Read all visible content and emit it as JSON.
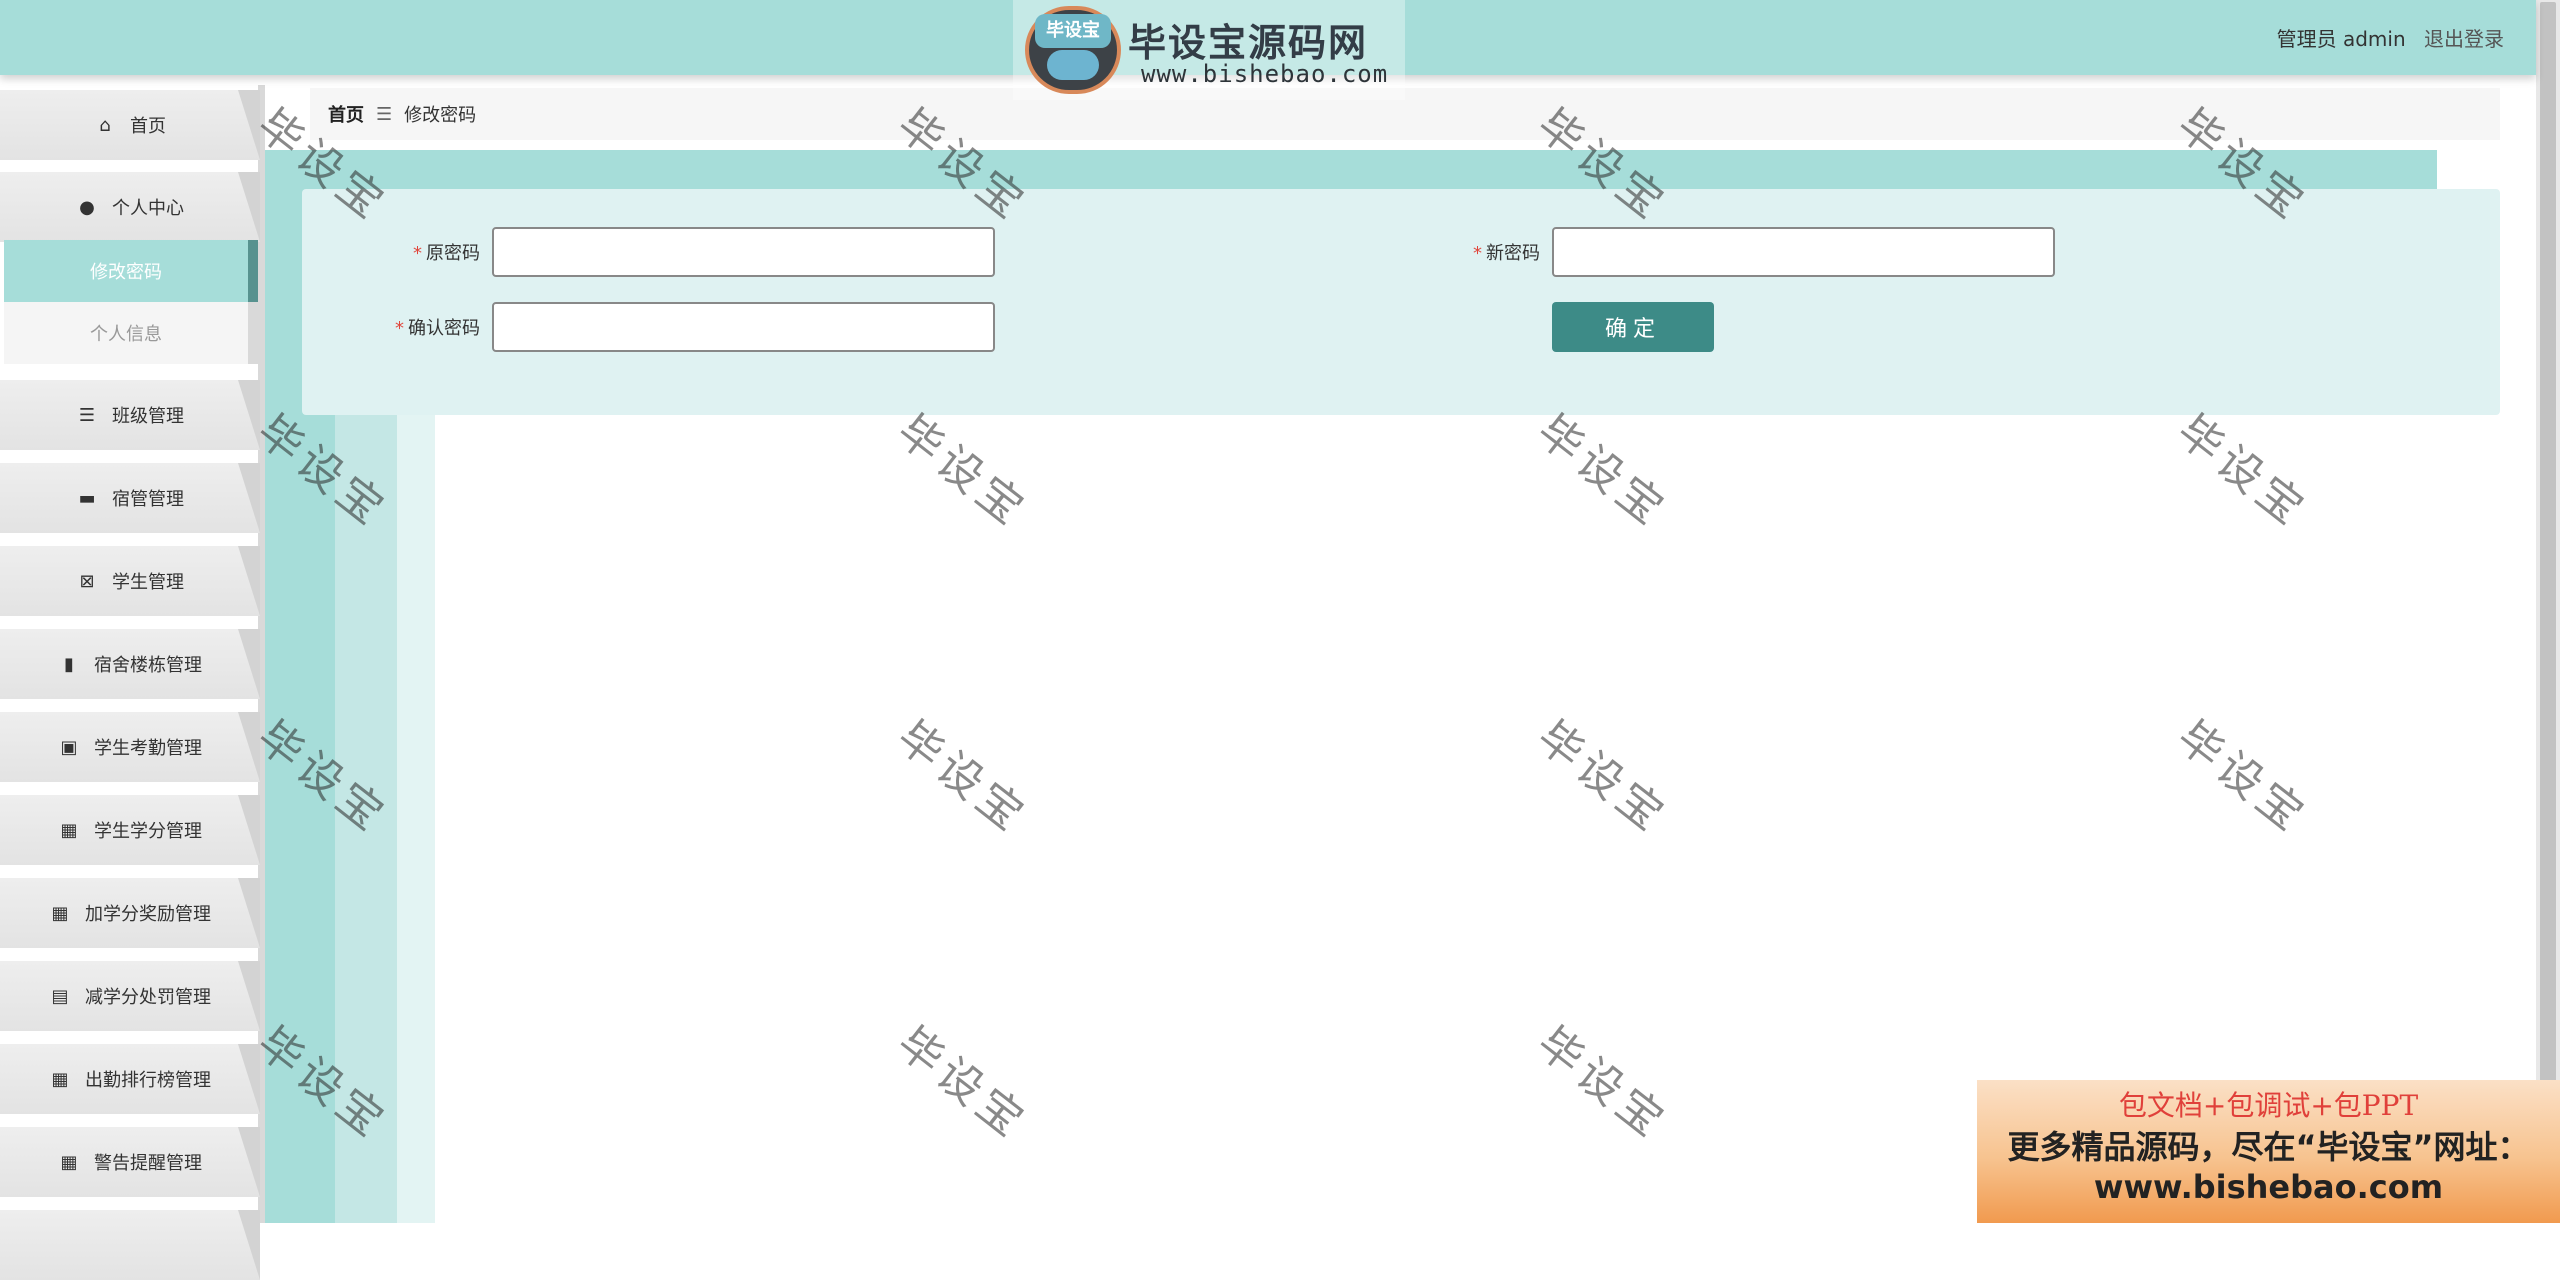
{
  "header": {
    "logo_cap": "毕设宝",
    "logo_title": "毕设宝源码网",
    "logo_url": "www.bishebao.com",
    "role_text": "管理员 admin",
    "logout_label": "退出登录"
  },
  "sidebar": {
    "items": [
      {
        "label": "首页",
        "icon": "home-icon",
        "glyph": "⌂"
      },
      {
        "label": "个人中心",
        "icon": "user-icon",
        "glyph": "●"
      },
      {
        "label": "班级管理",
        "icon": "sliders-icon",
        "glyph": "☰"
      },
      {
        "label": "宿管管理",
        "icon": "bed-icon",
        "glyph": "▬"
      },
      {
        "label": "学生管理",
        "icon": "clipboard-x-icon",
        "glyph": "⊠"
      },
      {
        "label": "宿舍楼栋管理",
        "icon": "bar-chart-icon",
        "glyph": "▮"
      },
      {
        "label": "学生考勤管理",
        "icon": "briefcase-icon",
        "glyph": "▣"
      },
      {
        "label": "学生学分管理",
        "icon": "grid-icon",
        "glyph": "▦"
      },
      {
        "label": "加学分奖励管理",
        "icon": "grid-icon",
        "glyph": "▦"
      },
      {
        "label": "减学分处罚管理",
        "icon": "clipboard-icon",
        "glyph": "▤"
      },
      {
        "label": "出勤排行榜管理",
        "icon": "grid-icon",
        "glyph": "▦"
      },
      {
        "label": "警告提醒管理",
        "icon": "grid-icon",
        "glyph": "▦"
      }
    ],
    "sub_items": [
      {
        "label": "修改密码",
        "active": true
      },
      {
        "label": "个人信息",
        "active": false
      }
    ]
  },
  "breadcrumb": {
    "home": "首页",
    "separator": "☰",
    "current": "修改密码"
  },
  "form": {
    "required_mark": "*",
    "old_password_label": "原密码",
    "new_password_label": "新密码",
    "confirm_password_label": "确认密码",
    "old_password_value": "",
    "new_password_value": "",
    "confirm_password_value": "",
    "submit_label": "确定"
  },
  "watermark": {
    "text": "毕设宝"
  },
  "ad": {
    "line1": "包文档+包调试+包PPT",
    "line2": "更多精品源码，尽在“毕设宝”网址：",
    "line3": "www.bishebao.com"
  },
  "colors": {
    "primary": "#a6ddd9",
    "button": "#3d8b87",
    "panel": "#dff2f2",
    "required": "#e0463c"
  }
}
